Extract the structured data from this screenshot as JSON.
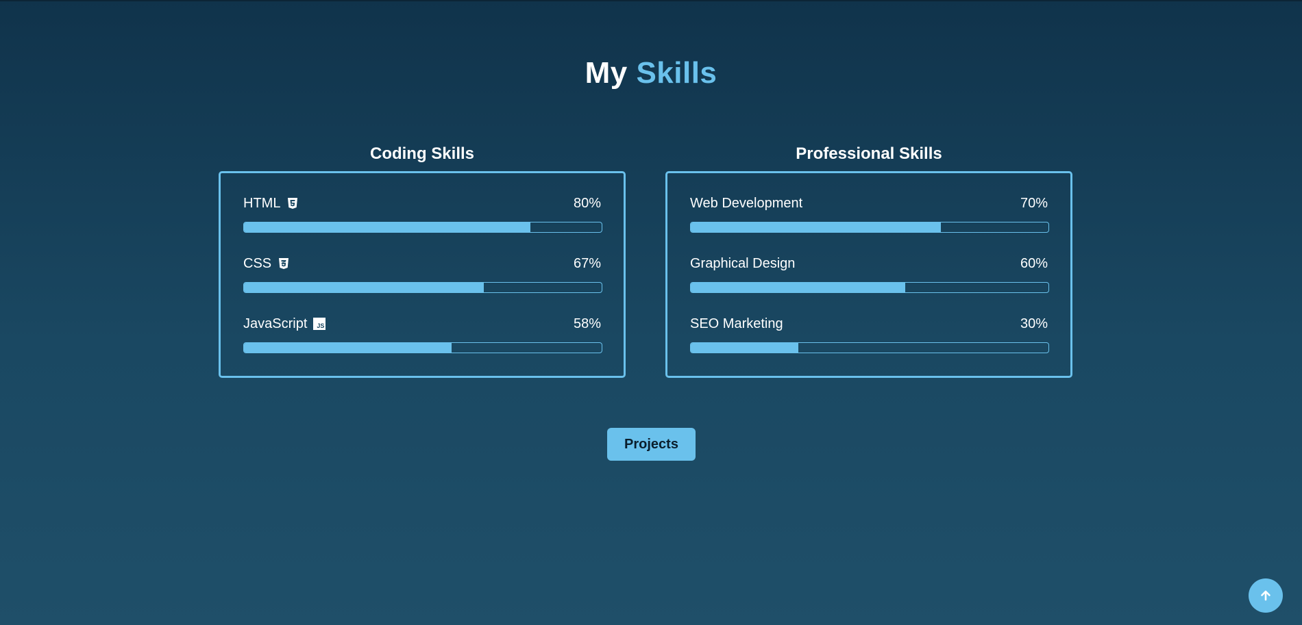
{
  "header": {
    "title_part1": "My",
    "title_part2": "Skills",
    "accent_color": "#6ac1ec"
  },
  "coding": {
    "title": "Coding Skills",
    "skills": [
      {
        "name": "HTML",
        "percent_label": "80%",
        "value": 80,
        "icon": "html5-icon"
      },
      {
        "name": "CSS",
        "percent_label": "67%",
        "value": 67,
        "icon": "css3-icon"
      },
      {
        "name": "JavaScript",
        "percent_label": "58%",
        "value": 58,
        "icon": "javascript-icon",
        "icon_text": "JS"
      }
    ]
  },
  "professional": {
    "title": "Professional Skills",
    "skills": [
      {
        "name": "Web Development",
        "percent_label": "70%",
        "value": 70
      },
      {
        "name": "Graphical Design",
        "percent_label": "60%",
        "value": 60
      },
      {
        "name": "SEO Marketing",
        "percent_label": "30%",
        "value": 30
      }
    ]
  },
  "actions": {
    "projects_label": "Projects",
    "scroll_top_icon": "arrow-up-icon"
  }
}
